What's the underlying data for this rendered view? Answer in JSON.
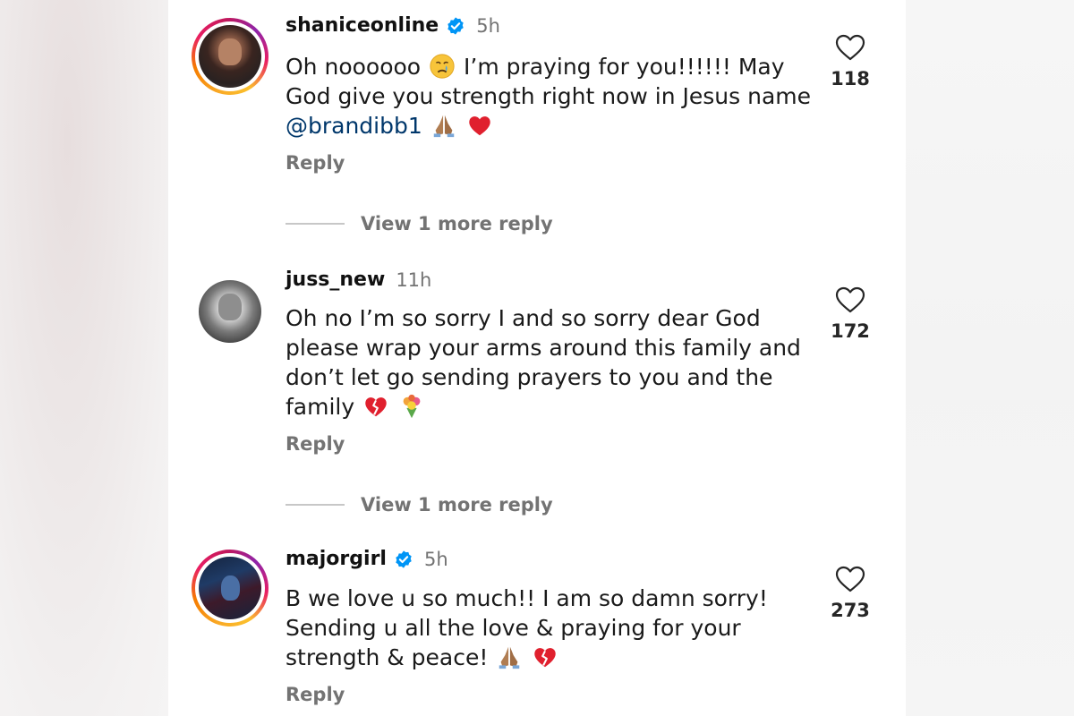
{
  "comments": [
    {
      "username": "shaniceonline",
      "verified": true,
      "time": "5h",
      "text_before_emoji": "Oh noooooo",
      "text_after_emoji": " I’m praying for you!!!!!! May God give you strength right now in Jesus name ",
      "mention": "@brandibb1",
      "emojis": [
        "crying-face",
        "folded-hands",
        "red-heart"
      ],
      "likes": "118",
      "reply_label": "Reply",
      "view_more_label": "View 1 more reply"
    },
    {
      "username": "juss_new",
      "verified": false,
      "time": "11h",
      "text": "Oh no I’m so sorry I and so sorry dear God please wrap your arms around this family and don’t let go sending prayers to you and the family",
      "emojis": [
        "broken-heart",
        "bouquet"
      ],
      "likes": "172",
      "reply_label": "Reply",
      "view_more_label": "View 1 more reply"
    },
    {
      "username": "majorgirl",
      "verified": true,
      "time": "5h",
      "text": "B we love u so much!! I am so damn sorry! Sending u all the love & praying for your strength & peace!",
      "emojis": [
        "folded-hands",
        "broken-heart"
      ],
      "likes": "273",
      "reply_label": "Reply"
    }
  ],
  "colors": {
    "mention": "#00376b",
    "secondary_text": "#737373",
    "verified_badge": "#0095f6"
  }
}
